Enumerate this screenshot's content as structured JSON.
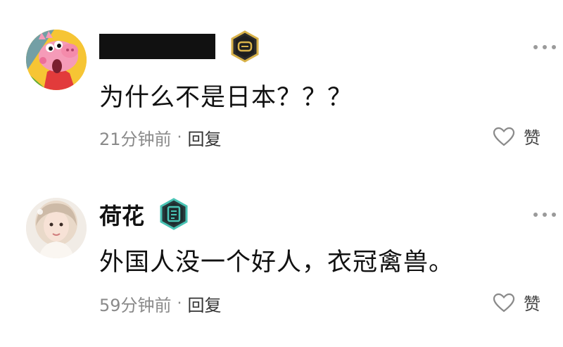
{
  "comments": [
    {
      "author": "",
      "text": "为什么不是日本？？？",
      "time": "21分钟前",
      "reply_label": "回复",
      "like_label": "赞"
    },
    {
      "author": "荷花",
      "text": "外国人没一个好人，衣冠禽兽。",
      "time": "59分钟前",
      "reply_label": "回复",
      "like_label": "赞"
    }
  ],
  "meta_separator": "·",
  "colors": {
    "badge_gold": "#d8b24a",
    "badge_teal": "#49c3b4",
    "meta_gray": "#8a8a8a"
  }
}
